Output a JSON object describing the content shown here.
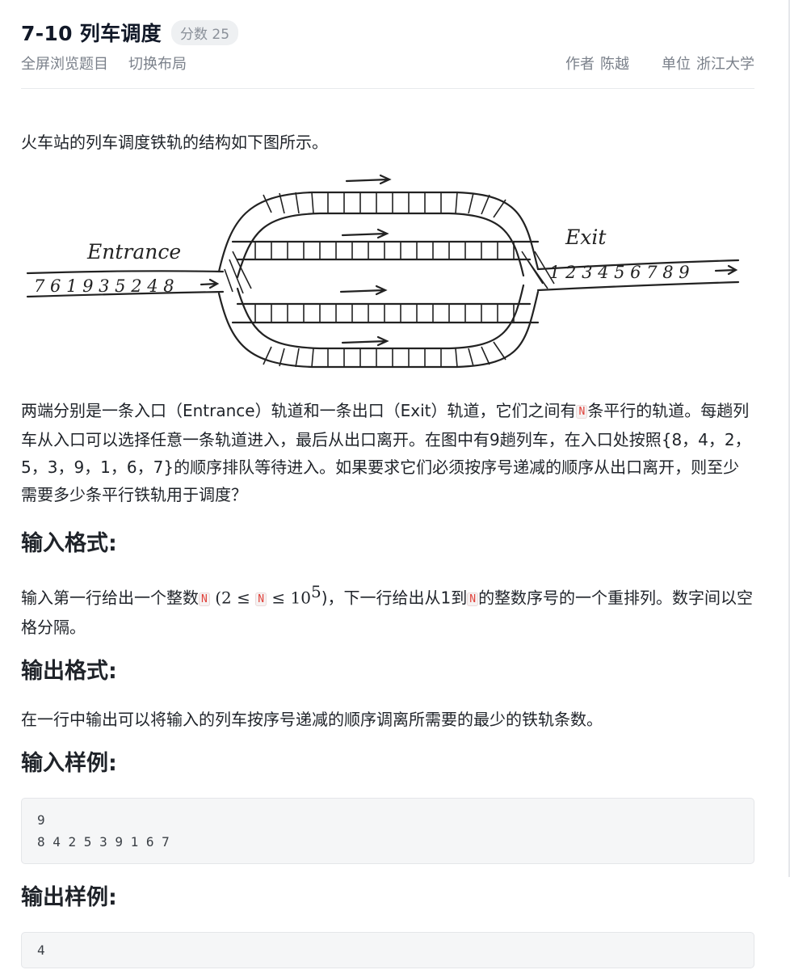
{
  "header": {
    "title": "7-10 列车调度",
    "score_label": "分数 25",
    "links": [
      "全屏浏览题目",
      "切换布局"
    ],
    "author_label": "作者",
    "author": "陈越",
    "unit_label": "单位",
    "unit": "浙江大学"
  },
  "problem": {
    "intro": "火车站的列车调度铁轨的结构如下图所示。",
    "figure": {
      "entrance_label": "Entrance",
      "exit_label": "Exit",
      "entrance_sequence": "7 6 1 9 3 5 2 4 8",
      "exit_sequence": "1 2 3 4 5 6 7 8 9"
    },
    "desc_1": "两端分别是一条入口（Entrance）轨道和一条出口（Exit）轨道，它们之间有",
    "var_n": "N",
    "desc_2": "条平行的轨道。每趟列车从入口可以选择任意一条轨道进入，最后从出口离开。在图中有9趟列车，在入口处按照{8，4，2，5，3，9，1，6，7}的顺序排队等待进入。如果要求它们必须按序号递减的顺序从出口离开，则至少需要多少条平行铁轨用于调度？"
  },
  "input_spec": {
    "heading": "输入格式:",
    "text_1": "输入第一行给出一个整数",
    "text_2": "(2 ≤",
    "text_3": "≤ 10",
    "exponent": "5",
    "text_4": ")，下一行给出从1到",
    "text_5": "的整数序号的一个重排列。数字间以空格分隔。"
  },
  "output_spec": {
    "heading": "输出格式:",
    "text": "在一行中输出可以将输入的列车按序号递减的顺序调离所需要的最少的铁轨条数。"
  },
  "sample_input": {
    "heading": "输入样例:",
    "code": "9\n8 4 2 5 3 9 1 6 7"
  },
  "sample_output": {
    "heading": "输出样例:",
    "code": "4"
  }
}
